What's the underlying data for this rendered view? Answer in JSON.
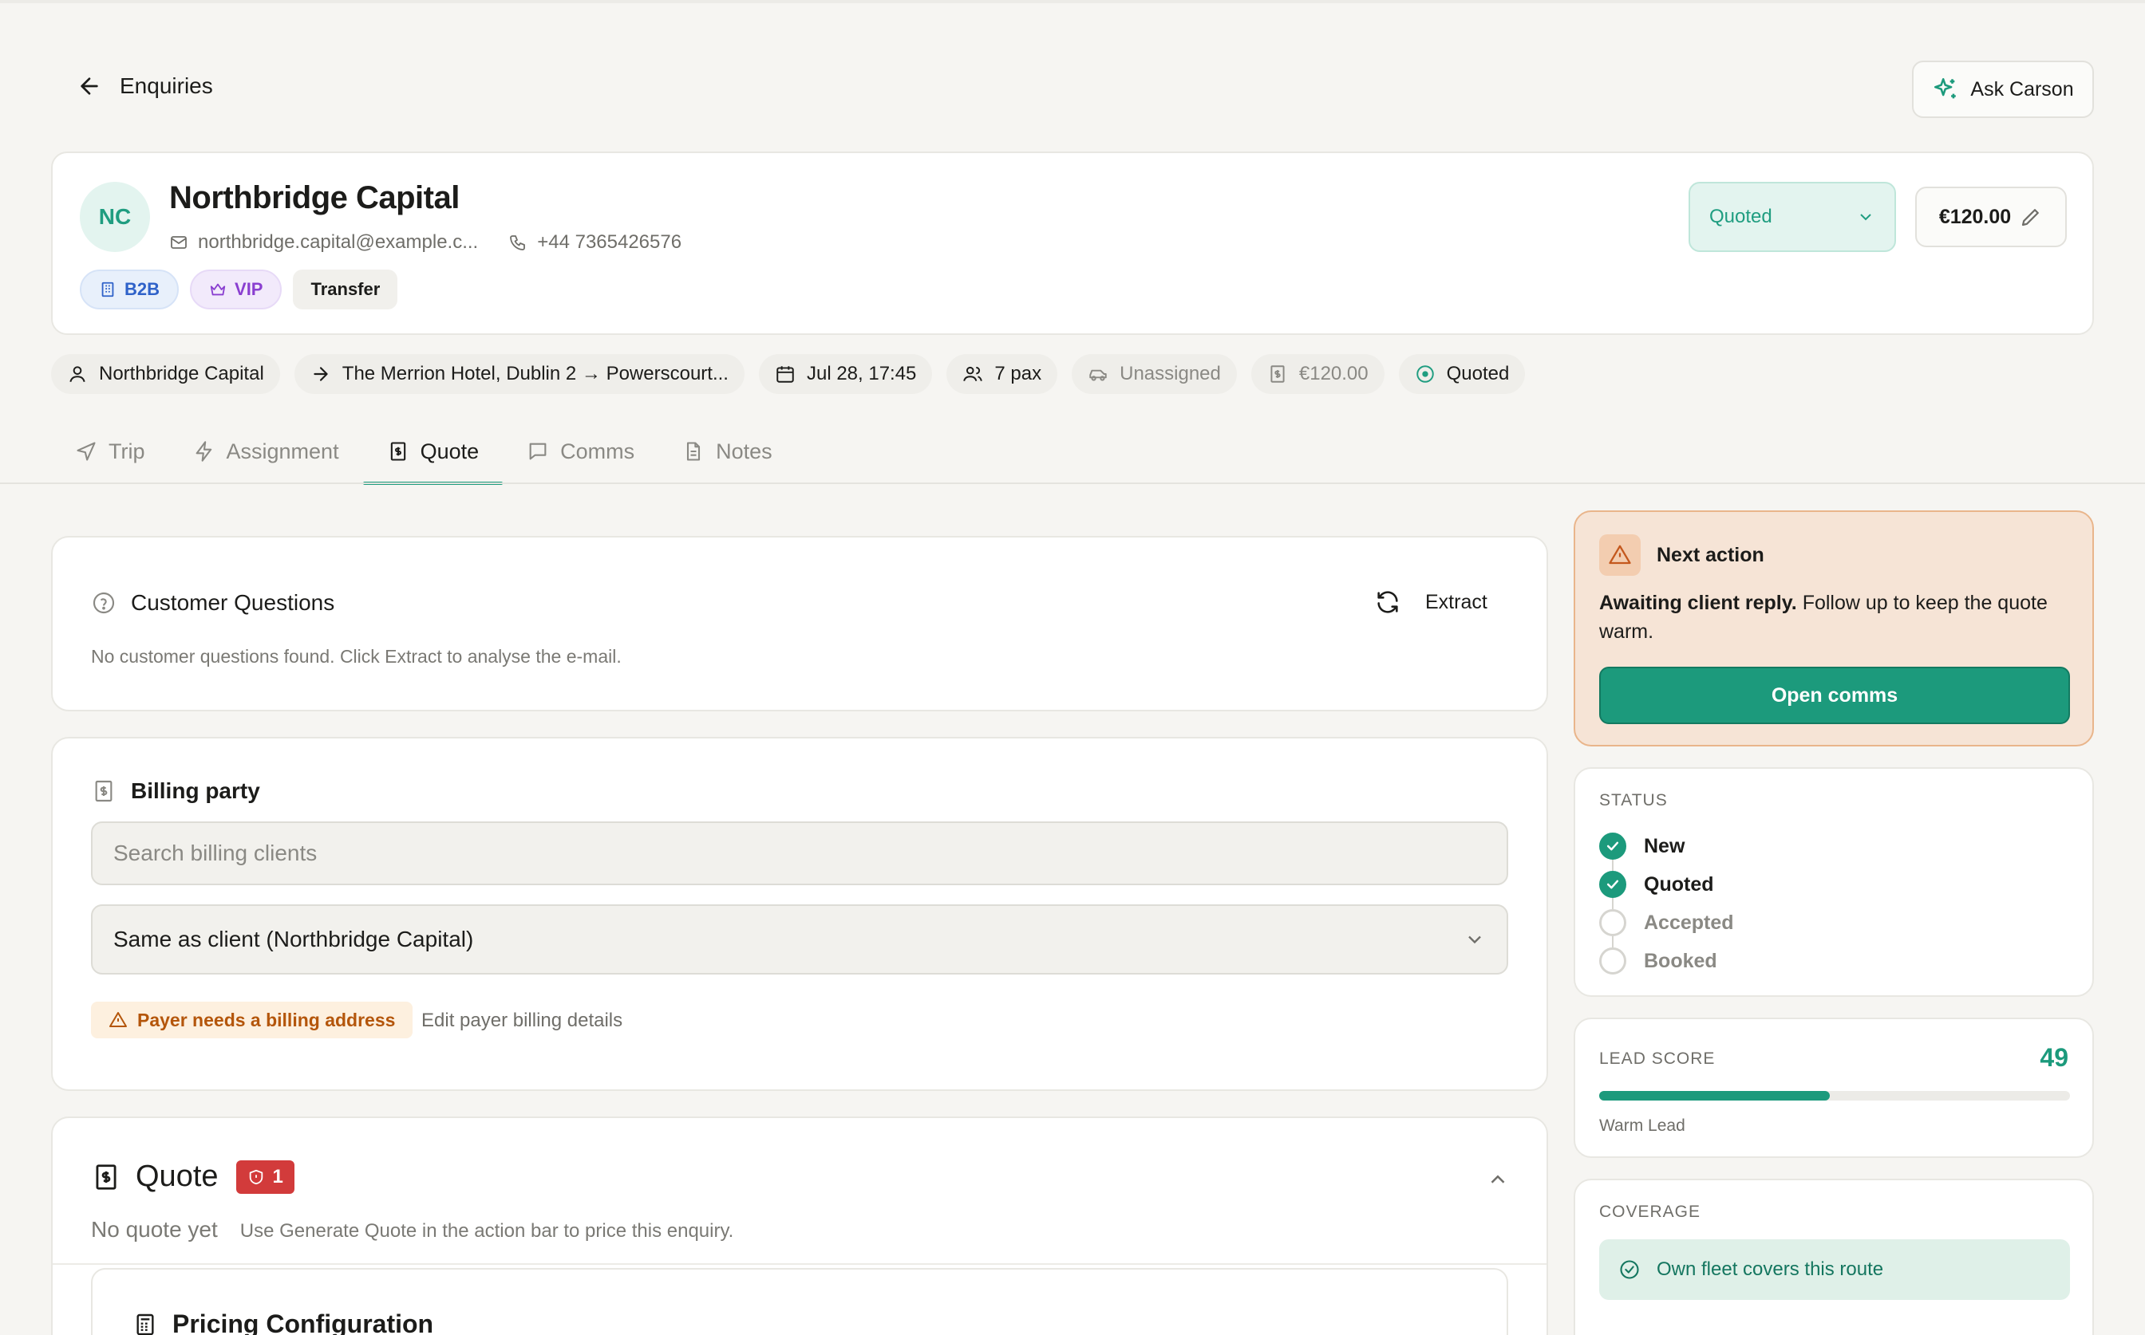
{
  "header": {
    "back_label": "Enquiries",
    "assistant_label": "Ask Carson"
  },
  "client": {
    "initials": "NC",
    "name": "Northbridge Capital",
    "email": "northbridge.capital@example.c...",
    "phone": "+44  7365426576",
    "badges": {
      "b2b": "B2B",
      "vip": "VIP",
      "transfer": "Transfer"
    },
    "status": "Quoted",
    "price": "€120.00"
  },
  "summary": {
    "client": "Northbridge Capital",
    "route": "The Merrion Hotel, Dublin 2 → Powerscourt...",
    "datetime": "Jul 28, 17:45",
    "pax": "7 pax",
    "driver": "Unassigned",
    "price": "€120.00",
    "status": "Quoted"
  },
  "tabs": {
    "trip": "Trip",
    "assignment": "Assignment",
    "quote": "Quote",
    "comms": "Comms",
    "notes": "Notes",
    "active": "Quote"
  },
  "customer_questions": {
    "title": "Customer Questions",
    "extract_label": "Extract",
    "empty_text": "No customer questions found. Click Extract to analyse the e-mail."
  },
  "billing": {
    "title": "Billing party",
    "search_placeholder": "Search billing clients",
    "selected": "Same as client (Northbridge Capital)",
    "warning": "Payer needs a billing address",
    "edit_link": "Edit payer billing details"
  },
  "quote": {
    "title": "Quote",
    "alert_count": "1",
    "empty_title": "No quote yet",
    "empty_hint": "Use Generate Quote in the action bar to price this enquiry.",
    "pricing_title": "Pricing Configuration"
  },
  "next_action": {
    "title": "Next action",
    "body_bold": "Awaiting client reply.",
    "body_rest": " Follow up to keep the quote warm.",
    "button": "Open comms"
  },
  "status_panel": {
    "label": "STATUS",
    "steps": [
      {
        "label": "New",
        "done": true
      },
      {
        "label": "Quoted",
        "done": true
      },
      {
        "label": "Accepted",
        "done": false
      },
      {
        "label": "Booked",
        "done": false
      }
    ]
  },
  "lead": {
    "label": "LEAD SCORE",
    "score": "49",
    "score_fraction": 0.49,
    "sub": "Warm Lead"
  },
  "coverage": {
    "label": "COVERAGE",
    "text": "Own fleet covers this route"
  },
  "colors": {
    "accent": "#1c9a7c",
    "warning": "#b4560b",
    "danger": "#d23b3b"
  }
}
